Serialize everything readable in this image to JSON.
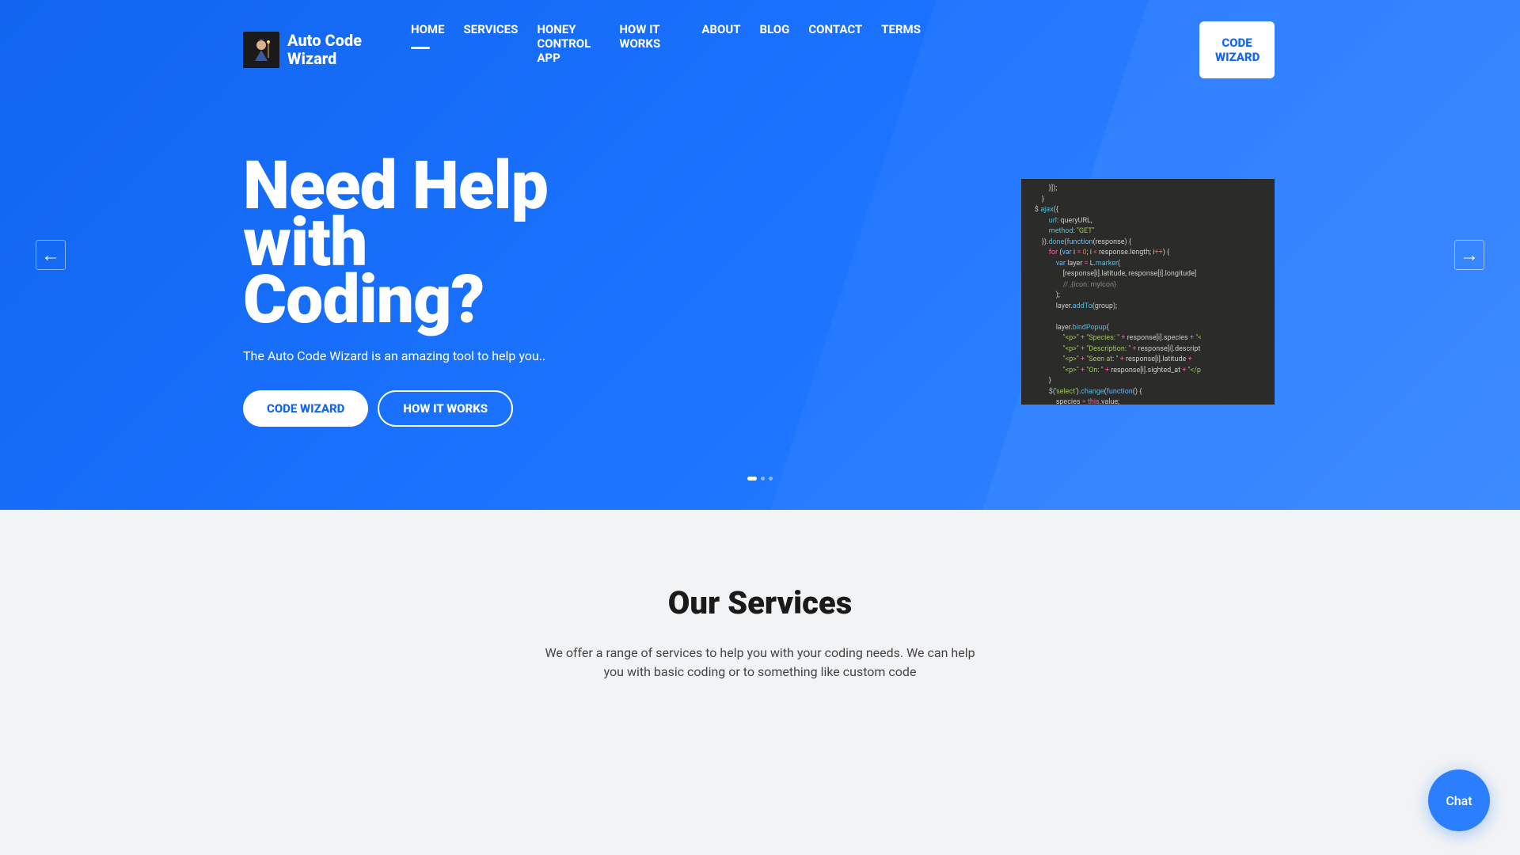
{
  "brand": {
    "name": "Auto Code Wizard"
  },
  "nav": {
    "items": [
      {
        "label": "HOME",
        "active": true
      },
      {
        "label": "SERVICES",
        "active": false
      },
      {
        "label": "HONEY CONTROL APP",
        "active": false
      },
      {
        "label": "HOW IT WORKS",
        "active": false
      },
      {
        "label": "ABOUT",
        "active": false
      },
      {
        "label": "BLOG",
        "active": false
      },
      {
        "label": "CONTACT",
        "active": false
      },
      {
        "label": "TERMS",
        "active": false
      }
    ],
    "cta": "CODE WIZARD"
  },
  "hero": {
    "title": "Need Help with Coding?",
    "subtitle": "The Auto Code Wizard is an amazing tool to help you..",
    "primary_btn": "CODE WIZARD",
    "secondary_btn": "HOW IT WORKS"
  },
  "slider": {
    "prev_label": "←",
    "next_label": "→",
    "active_index": 0,
    "count": 3
  },
  "services": {
    "title": "Our Services",
    "subtitle": "We offer a range of services to help you with your coding needs. We can help you with basic coding or to something like custom code"
  },
  "chat": {
    "label": "Chat"
  }
}
